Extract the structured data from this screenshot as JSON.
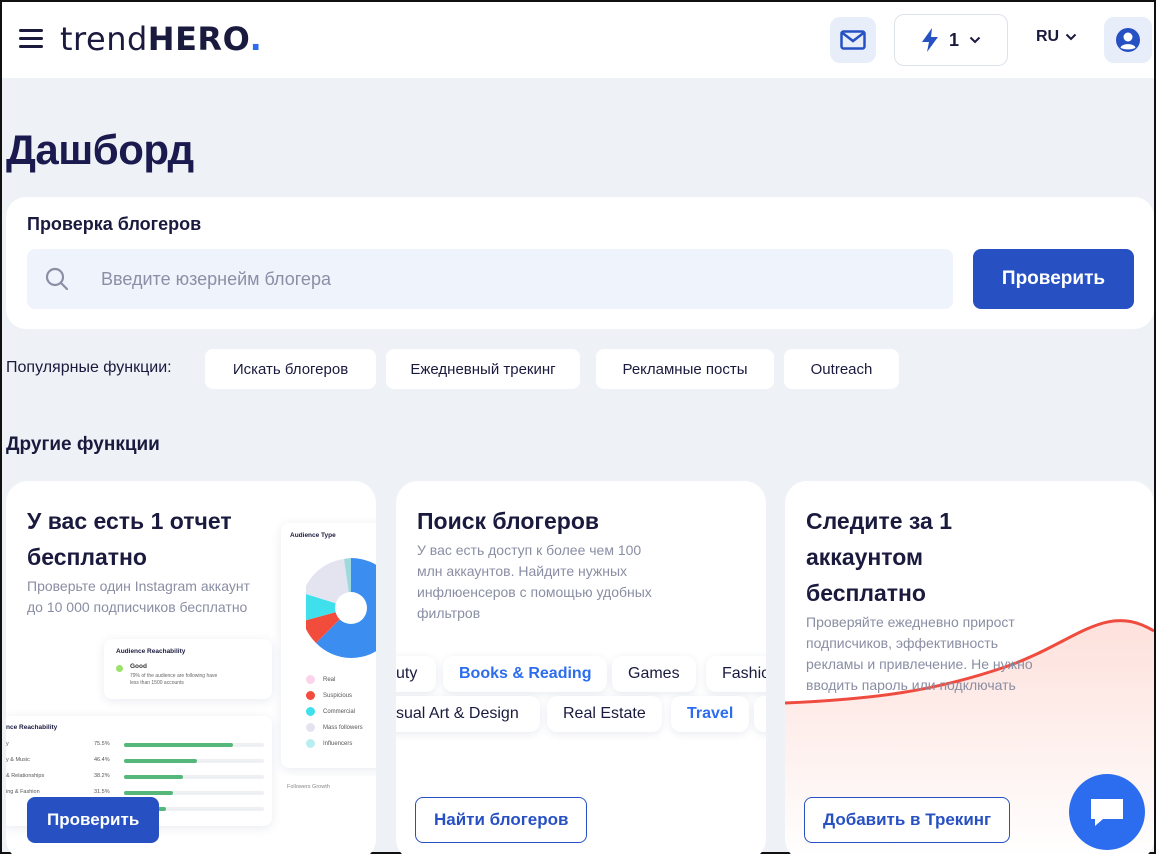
{
  "header": {
    "logo_light": "trend",
    "logo_bold": "HERO",
    "logo_dot": ".",
    "credits": "1",
    "language": "RU"
  },
  "page_title": "Дашборд",
  "check": {
    "title": "Проверка блогеров",
    "placeholder": "Введите юзернейм блогера",
    "button": "Проверить"
  },
  "popular": {
    "label": "Популярные функции:",
    "chips": [
      "Искать блогеров",
      "Ежедневный трекинг",
      "Рекламные посты",
      "Outreach"
    ]
  },
  "other_title": "Другие функции",
  "cards": [
    {
      "title_line1": "У вас есть 1 отчет",
      "title_line2": "бесплатно",
      "desc_line1": "Проверьте один Instagram аккаунт",
      "desc_line2": "до 10 000 подписчиков бесплатно",
      "button": "Проверить",
      "mock": {
        "audience_type_title": "Audience Type",
        "legend": [
          "Real",
          "Suspicious",
          "Commercial",
          "Mass followers",
          "Influencers"
        ],
        "reach_title": "Audience Reachability",
        "good_label": "Good",
        "good_desc_line1": "79% of the audience are following have",
        "good_desc_line2": "less than 1500 accounts",
        "reach_title2": "nce Reachability",
        "reach_rows": [
          {
            "label": "y",
            "pct": "75.5%",
            "fill": 0.78
          },
          {
            "label": "y & Music",
            "pct": "46.4%",
            "fill": 0.52
          },
          {
            "label": "& Relationships",
            "pct": "38.2%",
            "fill": 0.42
          },
          {
            "label": "ing & Fashion",
            "pct": "31.5%",
            "fill": 0.35
          },
          {
            "label": "",
            "pct": "",
            "fill": 0.3
          }
        ],
        "followers_growth": "Followers Growth"
      }
    },
    {
      "title": "Поиск блогеров",
      "desc_lines": [
        "У вас есть доступ к более чем 100",
        "млн аккаунтов. Найдите нужных",
        "инфлюенсеров с помощью удобных",
        "фильтров"
      ],
      "tags_row1": [
        "uty",
        "Books & Reading",
        "Games",
        "Fashio"
      ],
      "tags_row2": [
        "sual Art & Design",
        "Real Estate",
        "Travel"
      ],
      "button": "Найти блогеров"
    },
    {
      "title_lines": [
        "Следите за 1",
        "аккаунтом",
        "бесплатно"
      ],
      "desc_lines": [
        "Проверяйте ежедневно прирост",
        "подписчиков, эффективность",
        "рекламы и привлечение. Не нужно",
        "вводить пароль или подключать"
      ],
      "button": "Добавить в Трекинг"
    }
  ],
  "colors": {
    "accent": "#2751c3",
    "brand_dot": "#2c6df0",
    "tracking_line": "#ef4b3f"
  }
}
